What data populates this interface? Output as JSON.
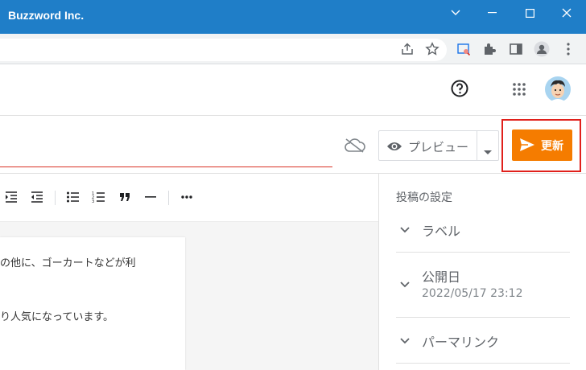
{
  "window": {
    "title": "Buzzword Inc."
  },
  "preview_button": {
    "label": "プレビュー"
  },
  "update_button": {
    "label": "更新"
  },
  "editor": {
    "lines": [
      "の他に、ゴーカートなどが利",
      "り人気になっています。"
    ]
  },
  "sidebar": {
    "heading": "投稿の設定",
    "items": [
      {
        "label": "ラベル"
      },
      {
        "label": "公開日",
        "value": "2022/05/17 23:12"
      },
      {
        "label": "パーマリンク"
      }
    ]
  },
  "colors": {
    "titlebar": "#1f7ec8",
    "update_button": "#f57c00",
    "highlight": "#e0201b"
  }
}
